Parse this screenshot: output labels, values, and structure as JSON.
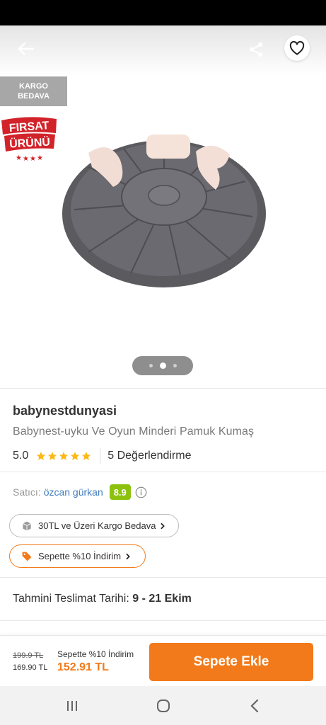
{
  "gallery": {
    "kargo_badge_line1": "KARGO",
    "kargo_badge_line2": "BEDAVA",
    "firsat_line1": "FIRSAT",
    "firsat_line2": "ÜRÜNÜ",
    "pager_active_index": 2,
    "pager_count": 3
  },
  "product": {
    "brand": "babynestdunyasi",
    "name": "Babynest-uyku Ve Oyun Minderi Pamuk Kumaş",
    "rating": "5.0",
    "stars": 5,
    "reviews": "5 Değerlendirme"
  },
  "seller": {
    "label": "Satıcı:",
    "name": "özcan gürkan",
    "score": "8.9"
  },
  "pills": {
    "cargo": "30TL ve Üzeri Kargo Bedava",
    "discount": "Sepette %10 İndirim"
  },
  "delivery": {
    "label": "Tahmini Teslimat Tarihi:",
    "range": "9 - 21 Ekim"
  },
  "bottom": {
    "old_price": "199.9 TL",
    "mid_price": "169.90 TL",
    "promo_label": "Sepette %10 İndirim",
    "final_price": "152.91 TL",
    "cart_button": "Sepete Ekle"
  },
  "colors": {
    "accent": "#f27a1a",
    "seller_score": "#8cc20e",
    "seller_link": "#3f7bbf",
    "star": "#fdb813"
  }
}
